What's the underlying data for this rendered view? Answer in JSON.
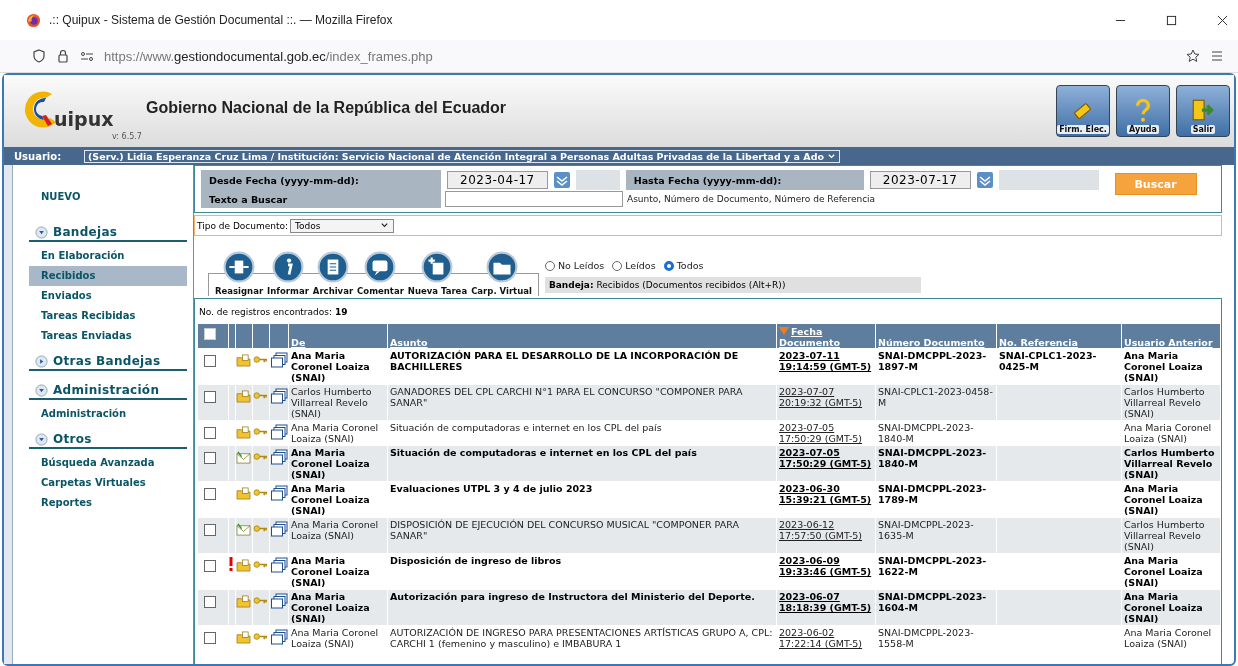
{
  "browser": {
    "title": ".:: Quipux - Sistema de Gestión Documental ::. — Mozilla Firefox",
    "url": {
      "prefix": "https://www.",
      "domain": "gestiondocumental.gob.ec",
      "path": "/index_frames.php"
    }
  },
  "header": {
    "logo": "uipux",
    "version": "v: 6.5.7",
    "title": "Gobierno Nacional de la República del Ecuador",
    "buttons": [
      {
        "label": "Firm. Elec.",
        "kind": "usb"
      },
      {
        "label": "Ayuda",
        "kind": "help"
      },
      {
        "label": "Salir",
        "kind": "exit"
      }
    ]
  },
  "user_bar": {
    "label": "Usuario:",
    "value": "(Serv.) Lidia Esperanza Cruz Lima / Institución: Servicio Nacional de Atención Integral a Personas Adultas Privadas de la Libertad y a Ado"
  },
  "sidebar": [
    {
      "kind": "link",
      "label": "NUEVO"
    },
    {
      "kind": "section",
      "label": "Bandejas",
      "expanded": true,
      "children": [
        {
          "label": "En Elaboración",
          "selected": false
        },
        {
          "label": "Recibidos",
          "selected": true
        },
        {
          "label": "Enviados",
          "selected": false
        },
        {
          "label": "Tareas Recibidas",
          "selected": false
        },
        {
          "label": "Tareas Enviadas",
          "selected": false
        }
      ]
    },
    {
      "kind": "section",
      "label": "Otras Bandejas",
      "expanded": false
    },
    {
      "kind": "section",
      "label": "Administración",
      "expanded": true,
      "children": [
        {
          "label": "Administración",
          "selected": false
        }
      ]
    },
    {
      "kind": "section",
      "label": "Otros",
      "expanded": true,
      "children": [
        {
          "label": "Búsqueda Avanzada",
          "selected": false
        },
        {
          "label": "Carpetas Virtuales",
          "selected": false
        },
        {
          "label": "Reportes",
          "selected": false
        }
      ]
    }
  ],
  "filters": {
    "from_label": "Desde Fecha (yyyy-mm-dd):",
    "from": "2023-04-17",
    "to_label": "Hasta Fecha (yyyy-mm-dd):",
    "to": "2023-07-17",
    "search_button": "Buscar",
    "text_label": "Texto a Buscar",
    "text_hint": "Asunto, Número de Documento, Número de Referencia",
    "doc_type_label": "Tipo de Documento:",
    "doc_type": "Todos"
  },
  "toolbar": [
    {
      "label": "Reasignar",
      "kind": "reassign"
    },
    {
      "label": "Informar",
      "kind": "info"
    },
    {
      "label": "Archivar",
      "kind": "archive"
    },
    {
      "label": "Comentar",
      "kind": "comment"
    },
    {
      "label": "Nueva Tarea",
      "kind": "task"
    },
    {
      "label": "Carp. Virtual",
      "kind": "folder"
    }
  ],
  "read_filter": [
    {
      "label": "No Leídos",
      "selected": false
    },
    {
      "label": "Leídos",
      "selected": false
    },
    {
      "label": "Todos",
      "selected": true
    }
  ],
  "bandeja": {
    "label": "Bandeja:",
    "value": "Recibidos (Documentos recibidos (Alt+R))"
  },
  "results": {
    "count_label": "No. de registros encontrados:",
    "count": "19"
  },
  "table": {
    "select_all": {
      "checked": false
    },
    "columns": [
      {
        "label": "De",
        "sorted": false
      },
      {
        "label": "Asunto",
        "sorted": false
      },
      {
        "label": "Fecha Documento",
        "sorted": true
      },
      {
        "label": "Número Documento",
        "sorted": false
      },
      {
        "label": "No. Referencia",
        "sorted": false
      },
      {
        "label": "Usuario Anterior",
        "sorted": false
      }
    ],
    "rows": [
      {
        "checked": false,
        "read": false,
        "urgent": false,
        "kind": "folder",
        "from": "Ana Maria Coronel Loaiza (SNAI)",
        "subject": "AUTORIZACIÓN PARA EL DESARROLLO DE LA INCORPORACIÓN DE BACHILLERES",
        "date": "2023-07-11 19:14:59 (GMT-5)",
        "number": "SNAI-DMCPPL-2023-1897-M",
        "reference": "SNAI-CPLC1-2023-0425-M",
        "previous": "Ana Maria Coronel Loaiza (SNAI)"
      },
      {
        "checked": false,
        "read": true,
        "urgent": false,
        "kind": "folder",
        "from": "Carlos Humberto Villarreal Revelo (SNAI)",
        "subject": "GANADORES DEL CPL CARCHI N°1 PARA EL CONCURSO \"COMPONER PARA SANAR\"",
        "date": "2023-07-07 20:19:32 (GMT-5)",
        "number": "SNAI-CPLC1-2023-0458-M",
        "previous": "Carlos Humberto Villarreal Revelo (SNAI)"
      },
      {
        "checked": false,
        "read": true,
        "urgent": false,
        "kind": "folder",
        "from": "Ana Maria Coronel Loaiza (SNAI)",
        "subject": "Situación de computadoras e internet en los CPL del país",
        "date": "2023-07-05 17:50:29 (GMT-5)",
        "number": "SNAI-DMCPPL-2023-1840-M",
        "previous": "Ana Maria Coronel Loaiza (SNAI)"
      },
      {
        "checked": false,
        "read": false,
        "urgent": false,
        "kind": "envelope",
        "from": "Ana Maria Coronel Loaiza (SNAI)",
        "subject": "Situación de computadoras e internet en los CPL del país",
        "date": "2023-07-05 17:50:29 (GMT-5)",
        "number": "SNAI-DMCPPL-2023-1840-M",
        "previous": "Carlos Humberto Villarreal Revelo (SNAI)"
      },
      {
        "checked": false,
        "read": false,
        "urgent": false,
        "kind": "folder",
        "from": "Ana Maria Coronel Loaiza (SNAI)",
        "subject": "Evaluaciones UTPL 3 y 4 de julio 2023",
        "date": "2023-06-30 15:39:21 (GMT-5)",
        "number": "SNAI-DMCPPL-2023-1789-M",
        "previous": "Ana Maria Coronel Loaiza (SNAI)"
      },
      {
        "checked": false,
        "read": true,
        "urgent": false,
        "kind": "envelope",
        "from": "Ana Maria Coronel Loaiza (SNAI)",
        "subject": "DISPOSICIÓN DE EJECUCIÓN DEL CONCURSO MUSICAL \"COMPONER PARA SANAR\"",
        "date": "2023-06-12 17:57:50 (GMT-5)",
        "number": "SNAI-DMCPPL-2023-1635-M",
        "previous": "Carlos Humberto Villarreal Revelo (SNAI)"
      },
      {
        "checked": false,
        "read": false,
        "urgent": true,
        "kind": "folder",
        "from": "Ana Maria Coronel Loaiza (SNAI)",
        "subject": "Disposición de ingreso de libros",
        "date": "2023-06-09 19:33:46 (GMT-5)",
        "number": "SNAI-DMCPPL-2023-1622-M",
        "previous": "Ana Maria Coronel Loaiza (SNAI)"
      },
      {
        "checked": false,
        "read": false,
        "urgent": false,
        "kind": "folder",
        "from": "Ana Maria Coronel Loaiza (SNAI)",
        "subject": "Autorización para ingreso de Instructora del Ministerio del Deporte.",
        "date": "2023-06-07 18:18:39 (GMT-5)",
        "number": "SNAI-DMCPPL-2023-1604-M",
        "previous": "Ana Maria Coronel Loaiza (SNAI)"
      },
      {
        "checked": false,
        "read": true,
        "urgent": false,
        "kind": "folder",
        "from": "Ana Maria Coronel Loaiza (SNAI)",
        "subject": "AUTORIZACIÓN DE INGRESO PARA PRESENTACIONES ARTÍSTICAS GRUPO A, CPL: CARCHI 1 (femenino y masculino) e IMBABURA 1",
        "date": "2023-06-02 17:22:14 (GMT-5)",
        "number": "SNAI-DMCPPL-2023-1558-M",
        "previous": "Ana Maria Coronel Loaiza (SNAI)"
      }
    ]
  }
}
